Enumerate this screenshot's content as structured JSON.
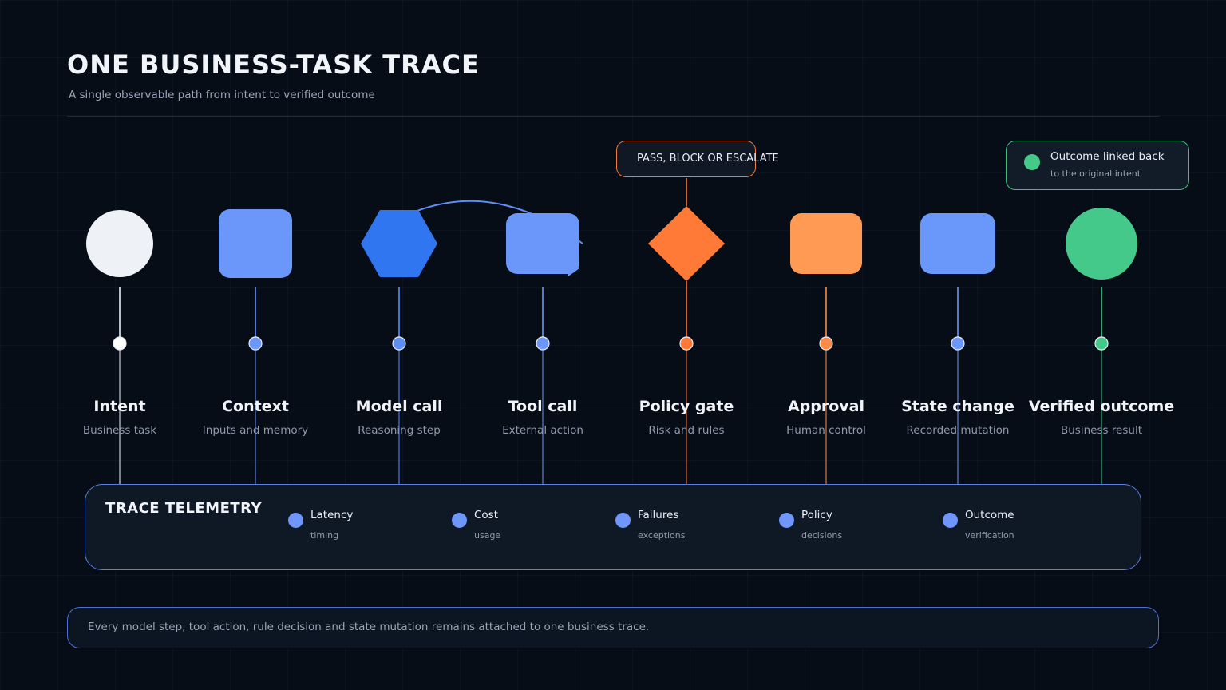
{
  "header": {
    "title": "ONE BUSINESS-TASK TRACE",
    "subtitle": "A single observable path from intent to verified outcome"
  },
  "stages": [
    {
      "label": "Intent",
      "sub": "Business task",
      "shape": "circle",
      "color": "#eef1f5",
      "dot_color": "#ffffff"
    },
    {
      "label": "Context",
      "sub": "Inputs and memory",
      "shape": "rounded-square",
      "color": "#6b97fb",
      "dot_color": "#6b97fb"
    },
    {
      "label": "Model call",
      "sub": "Reasoning step",
      "shape": "hexagon",
      "color": "#2f76f0",
      "dot_color": "#5d8df5"
    },
    {
      "label": "Tool call",
      "sub": "External action",
      "shape": "rounded-rect",
      "color": "#6b97fb",
      "dot_color": "#6b97fb"
    },
    {
      "label": "Policy gate",
      "sub": "Risk and rules",
      "shape": "diamond",
      "color": "#ff7a36",
      "dot_color": "#ff7a36"
    },
    {
      "label": "Approval",
      "sub": "Human control",
      "shape": "rounded-rect",
      "color": "#ff9a55",
      "dot_color": "#ff8a45"
    },
    {
      "label": "State change",
      "sub": "Recorded mutation",
      "shape": "rounded-rect",
      "color": "#6a98fa",
      "dot_color": "#6b97fb"
    },
    {
      "label": "Verified outcome",
      "sub": "Business result",
      "shape": "circle",
      "color": "#45c98a",
      "dot_color": "#45c98a"
    }
  ],
  "policy_callout": {
    "text": "PASS, BLOCK OR ESCALATE",
    "color": "#f07a3f"
  },
  "outcome_callout": {
    "line1": "Outcome linked back",
    "line2": "to the original intent",
    "color": "#3fbf7a"
  },
  "telemetry": {
    "title": "TRACE TELEMETRY",
    "metrics": [
      {
        "name": "Latency",
        "sub": "timing"
      },
      {
        "name": "Cost",
        "sub": "usage"
      },
      {
        "name": "Failures",
        "sub": "exceptions"
      },
      {
        "name": "Policy",
        "sub": "decisions"
      },
      {
        "name": "Outcome",
        "sub": "verification"
      }
    ]
  },
  "footer": {
    "text": "Every model step, tool action, rule decision and state mutation remains attached to one business trace."
  },
  "colors": {
    "background": "#070d17",
    "timeline": "#2d4f8c",
    "accent_blue": "#6b97fb",
    "accent_orange": "#ff7a36",
    "accent_green": "#45c98a"
  }
}
